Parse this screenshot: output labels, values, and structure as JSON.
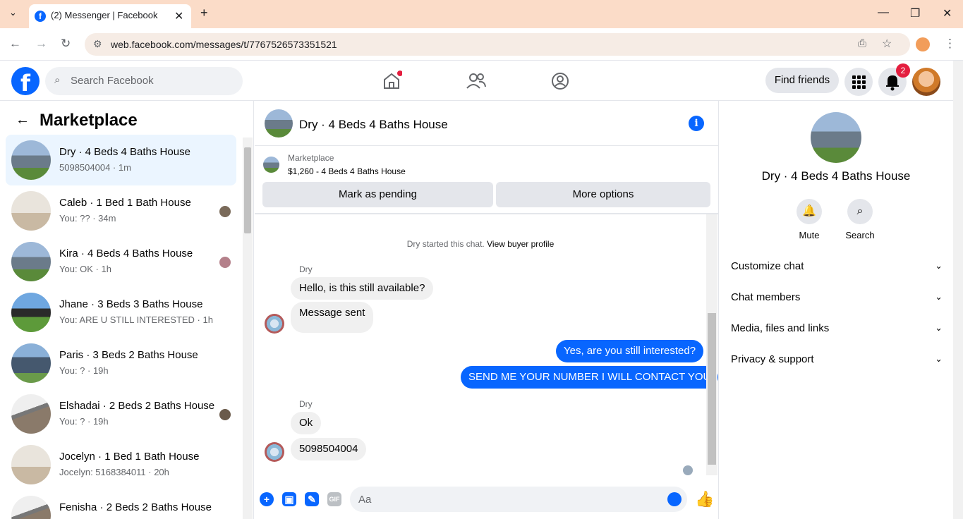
{
  "browser": {
    "tab_title": "(2) Messenger | Facebook",
    "url": "web.facebook.com/messages/t/7767526573351521"
  },
  "header": {
    "search_placeholder": "Search Facebook",
    "find_friends": "Find friends",
    "notification_count": "2"
  },
  "left": {
    "title": "Marketplace",
    "conversations": [
      {
        "name": "Dry · 4 Beds 4 Baths House",
        "sub": "5098504004 · 1m"
      },
      {
        "name": "Caleb · 1 Bed 1 Bath House",
        "sub": "You: ?? · 34m"
      },
      {
        "name": "Kira · 4 Beds 4 Baths House",
        "sub": "You: OK · 1h"
      },
      {
        "name": "Jhane · 3 Beds 3 Baths House",
        "sub": "You: ARE U STILL INTERESTED · 1h"
      },
      {
        "name": "Paris · 3 Beds 2 Baths House",
        "sub": "You: ? · 19h"
      },
      {
        "name": "Elshadai · 2 Beds 2 Baths House",
        "sub": "You: ? · 19h"
      },
      {
        "name": "Jocelyn · 1 Bed 1 Bath House",
        "sub": "Jocelyn: 5168384011 · 20h"
      },
      {
        "name": "Fenisha · 2 Beds 2 Baths House",
        "sub": ""
      }
    ]
  },
  "chat": {
    "title": "Dry · 4 Beds 4 Baths House",
    "marketplace_label": "Marketplace",
    "listing": "$1,260 - 4 Beds 4 Baths House",
    "mark_pending": "Mark as pending",
    "more_options": "More options",
    "system_text": "Dry started this chat.",
    "system_link": "View buyer profile",
    "sender1": "Dry",
    "msg1": "Hello, is this still available?",
    "msg2": "Message sent",
    "out1": "Yes, are you still interested?",
    "out2": "SEND ME YOUR NUMBER I WILL CONTACT YOU",
    "sender2": "Dry",
    "msg3": "Ok",
    "msg4": "5098504004",
    "input_placeholder": "Aa",
    "gif_label": "GIF"
  },
  "right": {
    "title": "Dry · 4 Beds 4 Baths House",
    "mute": "Mute",
    "search": "Search",
    "rows": [
      "Customize chat",
      "Chat members",
      "Media, files and links",
      "Privacy & support"
    ]
  }
}
